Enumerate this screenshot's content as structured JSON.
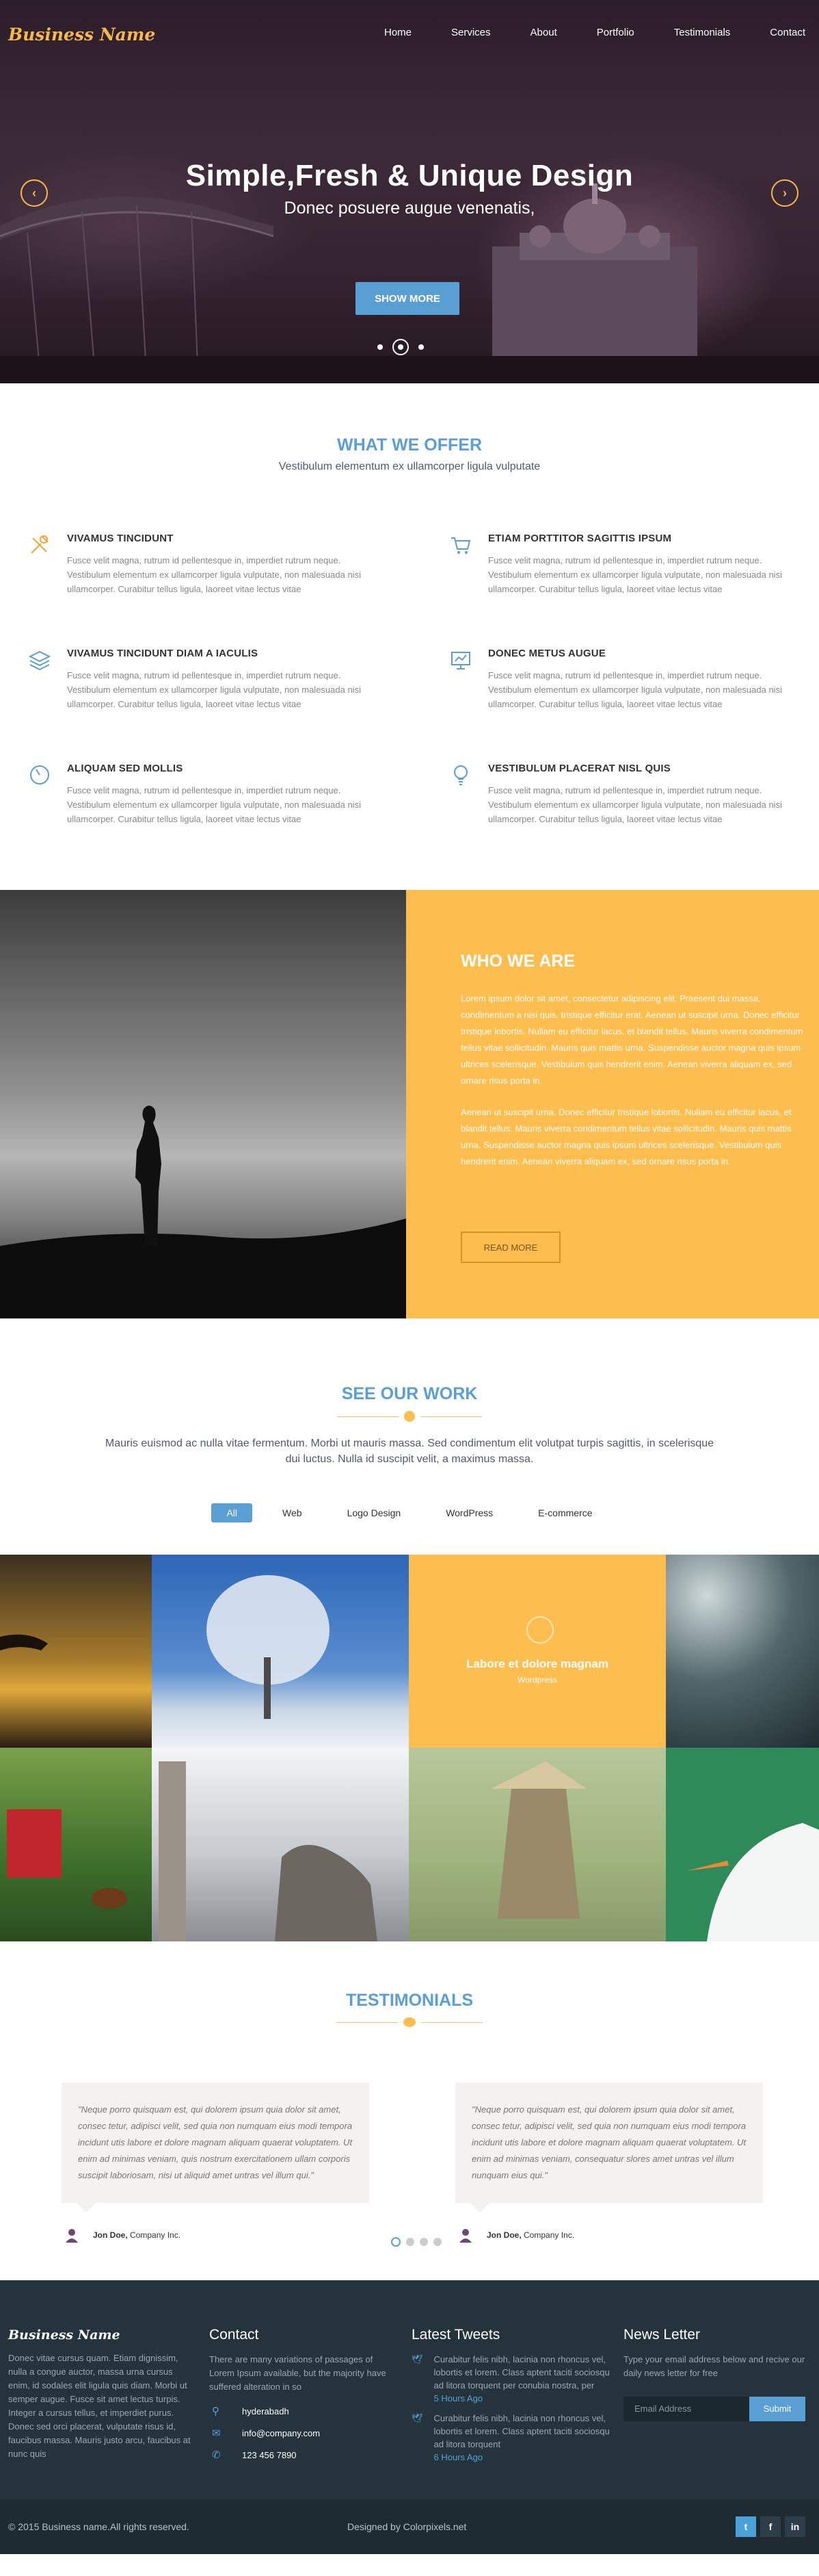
{
  "header": {
    "logo": "Business Name",
    "nav": [
      "Home",
      "Services",
      "About",
      "Portfolio",
      "Testimonials",
      "Contact"
    ]
  },
  "hero": {
    "title": "Simple,Fresh & Unique Design",
    "subtitle": "Donec posuere augue venenatis,",
    "button": "SHOW MORE",
    "prev_icon": "chevron-left-icon",
    "next_icon": "chevron-right-icon"
  },
  "offer": {
    "title": "WHAT WE OFFER",
    "subtitle": "Vestibulum elementum ex ullamcorper ligula vulputate",
    "features": [
      {
        "icon": "tools-icon",
        "title": "VIVAMUS TINCIDUNT",
        "text": "Fusce velit magna, rutrum id pellentesque in, imperdiet rutrum neque. Vestibulum elementum ex ullamcorper ligula vulputate, non malesuada nisi ullamcorper. Curabitur tellus ligula, laoreet vitae lectus vitae"
      },
      {
        "icon": "cart-icon",
        "title": "ETIAM PORTTITOR SAGITTIS IPSUM",
        "text": "Fusce velit magna, rutrum id pellentesque in, imperdiet rutrum neque. Vestibulum elementum ex ullamcorper ligula vulputate, non malesuada nisi ullamcorper. Curabitur tellus ligula, laoreet vitae lectus vitae"
      },
      {
        "icon": "layers-icon",
        "title": "VIVAMUS TINCIDUNT DIAM A IACULIS",
        "text": "Fusce velit magna, rutrum id pellentesque in, imperdiet rutrum neque. Vestibulum elementum ex ullamcorper ligula vulputate, non malesuada nisi ullamcorper. Curabitur tellus ligula, laoreet vitae lectus vitae"
      },
      {
        "icon": "presentation-icon",
        "title": "DONEC METUS AUGUE",
        "text": "Fusce velit magna, rutrum id pellentesque in, imperdiet rutrum neque. Vestibulum elementum ex ullamcorper ligula vulputate, non malesuada nisi ullamcorper. Curabitur tellus ligula, laoreet vitae lectus vitae"
      },
      {
        "icon": "speedometer-icon",
        "title": "ALIQUAM SED MOLLIS",
        "text": "Fusce velit magna, rutrum id pellentesque in, imperdiet rutrum neque. Vestibulum elementum ex ullamcorper ligula vulputate, non malesuada nisi ullamcorper. Curabitur tellus ligula, laoreet vitae lectus vitae"
      },
      {
        "icon": "lightbulb-icon",
        "title": "VESTIBULUM PLACERAT NISL QUIS",
        "text": "Fusce velit magna, rutrum id pellentesque in, imperdiet rutrum neque. Vestibulum elementum ex ullamcorper ligula vulputate, non malesuada nisi ullamcorper. Curabitur tellus ligula, laoreet vitae lectus vitae"
      }
    ]
  },
  "who": {
    "title": "WHO WE ARE",
    "para1": "Lorem ipsum dolor sit amet, consectetur adipiscing elit. Praesent dui massa, condimentum a nisi quis, tristique efficitur erat. Aenean ut suscipit urna. Donec efficitur tristique lobortis. Nullam eu efficitur lacus, et blandit tellus. Mauris viverra condimentum tellus vitae sollicitudin. Mauris quis mattis urna. Suspendisse auctor magna quis ipsum ultrices scelerisque. Vestibulum quis hendrerit enim. Aenean viverra aliquam ex, sed ornare risus porta in.",
    "para2": "Aenean ut suscipit urna. Donec efficitur tristique lobortis. Nullam eu efficitur lacus, et blandit tellus. Mauris viverra condimentum tellus vitae sollicitudin. Mauris quis mattis urna. Suspendisse auctor magna quis ipsum ultrices scelerisque. Vestibulum quis hendrerit enim. Aenean viverra aliquam ex, sed ornare risus porta in.",
    "button": "READ MORE"
  },
  "work": {
    "title": "SEE OUR WORK",
    "text": "Mauris euismod ac nulla vitae fermentum. Morbi ut mauris massa. Sed condimentum elit volutpat turpis sagittis, in scelerisque dui luctus. Nulla id suscipit velit, a maximus massa.",
    "filters": [
      "All",
      "Web",
      "Logo Design",
      "WordPress",
      "E-commerce"
    ],
    "active_filter": "All",
    "hover_title": "Labore et dolore magnam",
    "hover_sub": "Wordpress"
  },
  "testimonials": {
    "title": "TESTIMONIALS",
    "items": [
      {
        "quote": "\"Neque porro quisquam est, qui dolorem ipsum quia dolor sit amet, consec tetur, adipisci velit, sed quia non numquam eius modi tempora incidunt utis labore et dolore magnam aliquam quaerat voluptatem. Ut enim ad minimas veniam, quis nostrum exercitationem ullam corporis suscipit laboriosam, nisi ut aliquid amet untras vel illum qui.\"",
        "name": "Jon Doe,",
        "company": "Company Inc."
      },
      {
        "quote": "\"Neque porro quisquam est, qui dolorem ipsum quia dolor sit amet, consec tetur, adipisci velit, sed quia non numquam eius modi tempora incidunt utis labore et dolore magnam aliquam quaerat voluptatem. Ut enim ad minimas veniam, consequatur slores amet untras vel illum nunquam eius qui.\"",
        "name": "Jon Doe,",
        "company": "Company Inc."
      }
    ]
  },
  "footer": {
    "logo": "Business Name",
    "about": "Donec vitae cursus quam. Etiam dignissim, nulla a congue auctor, massa urna cursus enim, id sodales elit ligula quis diam. Morbi ut semper augue. Fusce sit amet lectus turpis. Integer a cursus tellus, et imperdiet purus. Donec sed orci placerat, vulputate risus id, faucibus massa. Mauris justo arcu, faucibus at nunc quis",
    "contact_title": "Contact",
    "contact_text": "There are many variations of passages of Lorem Ipsum available, but the majority have suffered alteration in so",
    "location": "hyderabadh",
    "email": "info@company.com",
    "phone": "123 456 7890",
    "tweets_title": "Latest Tweets",
    "tweets": [
      {
        "text": "Curabitur felis nibh, lacinia non rhoncus vel, lobortis et lorem. Class aptent taciti sociosqu ad litora torquent per conubia nostra, per",
        "ago": "5 Hours Ago"
      },
      {
        "text": "Curabitur felis nibh, lacinia non rhoncus vel, lobortis et lorem. Class aptent taciti sociosqu ad litora torquent",
        "ago": "6 Hours Ago"
      }
    ],
    "news_title": "News Letter",
    "news_text": "Type your email address below and recive our daily news letter for free",
    "email_placeholder": "Email Address",
    "submit": "Submit",
    "copyright": "© 2015 Business name.All rights reserved.",
    "designed": "Designed by Colorpixels.net",
    "social": [
      "t",
      "f",
      "in"
    ]
  },
  "colors": {
    "accent": "#5a9fd4",
    "yellow": "#fdbd4f",
    "footer": "#25333d"
  }
}
